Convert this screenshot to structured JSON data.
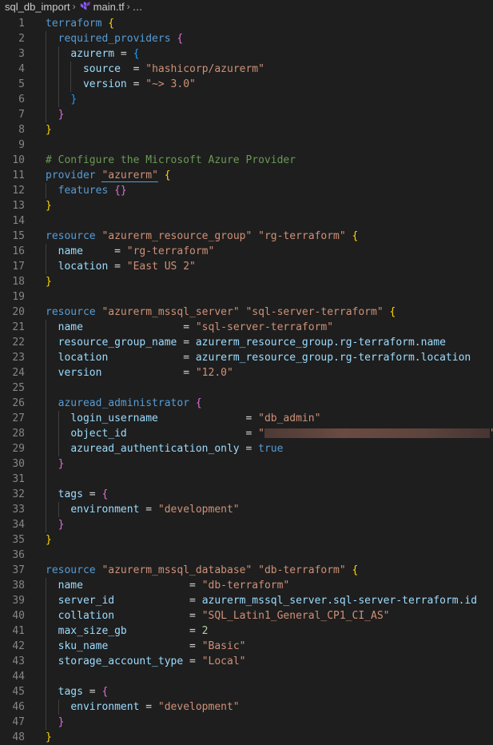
{
  "breadcrumb": {
    "folder": "sql_db_import",
    "file": "main.tf",
    "more": "…"
  },
  "editor": {
    "lines": [
      {
        "n": "1",
        "parts": [
          {
            "t": "terraform",
            "c": "kw"
          },
          {
            "t": " "
          },
          {
            "t": "{",
            "c": "br1"
          }
        ]
      },
      {
        "n": "2",
        "parts": [
          {
            "t": "  "
          },
          {
            "t": "required_providers",
            "c": "kw"
          },
          {
            "t": " "
          },
          {
            "t": "{",
            "c": "br2"
          }
        ]
      },
      {
        "n": "3",
        "parts": [
          {
            "t": "    "
          },
          {
            "t": "azurerm",
            "c": "id"
          },
          {
            "t": " = "
          },
          {
            "t": "{",
            "c": "br3"
          }
        ]
      },
      {
        "n": "4",
        "parts": [
          {
            "t": "      "
          },
          {
            "t": "source",
            "c": "id"
          },
          {
            "t": "  = "
          },
          {
            "t": "\"hashicorp/azurerm\"",
            "c": "str"
          }
        ]
      },
      {
        "n": "5",
        "parts": [
          {
            "t": "      "
          },
          {
            "t": "version",
            "c": "id"
          },
          {
            "t": " = "
          },
          {
            "t": "\"~> 3.0\"",
            "c": "str"
          }
        ]
      },
      {
        "n": "6",
        "parts": [
          {
            "t": "    "
          },
          {
            "t": "}",
            "c": "br3"
          }
        ]
      },
      {
        "n": "7",
        "parts": [
          {
            "t": "  "
          },
          {
            "t": "}",
            "c": "br2"
          }
        ]
      },
      {
        "n": "8",
        "parts": [
          {
            "t": "}",
            "c": "br1"
          }
        ]
      },
      {
        "n": "9",
        "parts": []
      },
      {
        "n": "10",
        "parts": [
          {
            "t": "# Configure the Microsoft Azure Provider",
            "c": "cm"
          }
        ]
      },
      {
        "n": "11",
        "parts": [
          {
            "t": "provider",
            "c": "kw"
          },
          {
            "t": " "
          },
          {
            "t": "\"azurerm\"",
            "c": "str",
            "ul": true
          },
          {
            "t": " "
          },
          {
            "t": "{",
            "c": "br1"
          }
        ]
      },
      {
        "n": "12",
        "parts": [
          {
            "t": "  "
          },
          {
            "t": "features",
            "c": "kw"
          },
          {
            "t": " "
          },
          {
            "t": "{}",
            "c": "br2"
          }
        ]
      },
      {
        "n": "13",
        "parts": [
          {
            "t": "}",
            "c": "br1"
          }
        ]
      },
      {
        "n": "14",
        "parts": []
      },
      {
        "n": "15",
        "parts": [
          {
            "t": "resource",
            "c": "kw"
          },
          {
            "t": " "
          },
          {
            "t": "\"azurerm_resource_group\"",
            "c": "str"
          },
          {
            "t": " "
          },
          {
            "t": "\"rg-terraform\"",
            "c": "str"
          },
          {
            "t": " "
          },
          {
            "t": "{",
            "c": "br1"
          }
        ]
      },
      {
        "n": "16",
        "parts": [
          {
            "t": "  "
          },
          {
            "t": "name",
            "c": "id"
          },
          {
            "t": "     = "
          },
          {
            "t": "\"rg-terraform\"",
            "c": "str"
          }
        ]
      },
      {
        "n": "17",
        "parts": [
          {
            "t": "  "
          },
          {
            "t": "location",
            "c": "id"
          },
          {
            "t": " = "
          },
          {
            "t": "\"East US 2\"",
            "c": "str"
          }
        ]
      },
      {
        "n": "18",
        "parts": [
          {
            "t": "}",
            "c": "br1"
          }
        ]
      },
      {
        "n": "19",
        "parts": []
      },
      {
        "n": "20",
        "parts": [
          {
            "t": "resource",
            "c": "kw"
          },
          {
            "t": " "
          },
          {
            "t": "\"azurerm_mssql_server\"",
            "c": "str"
          },
          {
            "t": " "
          },
          {
            "t": "\"sql-server-terraform\"",
            "c": "str"
          },
          {
            "t": " "
          },
          {
            "t": "{",
            "c": "br1"
          }
        ]
      },
      {
        "n": "21",
        "parts": [
          {
            "t": "  "
          },
          {
            "t": "name",
            "c": "id"
          },
          {
            "t": "                = "
          },
          {
            "t": "\"sql-server-terraform\"",
            "c": "str"
          }
        ]
      },
      {
        "n": "22",
        "parts": [
          {
            "t": "  "
          },
          {
            "t": "resource_group_name",
            "c": "id"
          },
          {
            "t": " = "
          },
          {
            "t": "azurerm_resource_group.rg-terraform.name",
            "c": "id"
          }
        ]
      },
      {
        "n": "23",
        "parts": [
          {
            "t": "  "
          },
          {
            "t": "location",
            "c": "id"
          },
          {
            "t": "            = "
          },
          {
            "t": "azurerm_resource_group.rg-terraform.location",
            "c": "id"
          }
        ]
      },
      {
        "n": "24",
        "parts": [
          {
            "t": "  "
          },
          {
            "t": "version",
            "c": "id"
          },
          {
            "t": "             = "
          },
          {
            "t": "\"12.0\"",
            "c": "str"
          }
        ]
      },
      {
        "n": "25",
        "parts": []
      },
      {
        "n": "26",
        "parts": [
          {
            "t": "  "
          },
          {
            "t": "azuread_administrator",
            "c": "kw"
          },
          {
            "t": " "
          },
          {
            "t": "{",
            "c": "br2"
          }
        ]
      },
      {
        "n": "27",
        "parts": [
          {
            "t": "    "
          },
          {
            "t": "login_username",
            "c": "id"
          },
          {
            "t": "              = "
          },
          {
            "t": "\"db_admin\"",
            "c": "str"
          }
        ]
      },
      {
        "n": "28",
        "parts": [
          {
            "t": "    "
          },
          {
            "t": "object_id",
            "c": "id"
          },
          {
            "t": "                   = "
          },
          {
            "t": "\"",
            "c": "str"
          },
          {
            "redacted": true
          },
          {
            "t": "\"",
            "c": "str"
          }
        ]
      },
      {
        "n": "29",
        "parts": [
          {
            "t": "    "
          },
          {
            "t": "azuread_authentication_only",
            "c": "id"
          },
          {
            "t": " = "
          },
          {
            "t": "true",
            "c": "kw"
          }
        ]
      },
      {
        "n": "30",
        "parts": [
          {
            "t": "  "
          },
          {
            "t": "}",
            "c": "br2"
          }
        ]
      },
      {
        "n": "31",
        "parts": []
      },
      {
        "n": "32",
        "parts": [
          {
            "t": "  "
          },
          {
            "t": "tags",
            "c": "id"
          },
          {
            "t": " = "
          },
          {
            "t": "{",
            "c": "br2"
          }
        ]
      },
      {
        "n": "33",
        "parts": [
          {
            "t": "    "
          },
          {
            "t": "environment",
            "c": "id"
          },
          {
            "t": " = "
          },
          {
            "t": "\"development\"",
            "c": "str"
          }
        ]
      },
      {
        "n": "34",
        "parts": [
          {
            "t": "  "
          },
          {
            "t": "}",
            "c": "br2"
          }
        ]
      },
      {
        "n": "35",
        "parts": [
          {
            "t": "}",
            "c": "br1"
          }
        ]
      },
      {
        "n": "36",
        "parts": []
      },
      {
        "n": "37",
        "parts": [
          {
            "t": "resource",
            "c": "kw"
          },
          {
            "t": " "
          },
          {
            "t": "\"azurerm_mssql_database\"",
            "c": "str"
          },
          {
            "t": " "
          },
          {
            "t": "\"db-terraform\"",
            "c": "str"
          },
          {
            "t": " "
          },
          {
            "t": "{",
            "c": "br1"
          }
        ]
      },
      {
        "n": "38",
        "parts": [
          {
            "t": "  "
          },
          {
            "t": "name",
            "c": "id"
          },
          {
            "t": "                 = "
          },
          {
            "t": "\"db-terraform\"",
            "c": "str"
          }
        ]
      },
      {
        "n": "39",
        "parts": [
          {
            "t": "  "
          },
          {
            "t": "server_id",
            "c": "id"
          },
          {
            "t": "            = "
          },
          {
            "t": "azurerm_mssql_server.sql-server-terraform.id",
            "c": "id"
          }
        ]
      },
      {
        "n": "40",
        "parts": [
          {
            "t": "  "
          },
          {
            "t": "collation",
            "c": "id"
          },
          {
            "t": "            = "
          },
          {
            "t": "\"SQL_Latin1_General_CP1_CI_AS\"",
            "c": "str"
          }
        ]
      },
      {
        "n": "41",
        "parts": [
          {
            "t": "  "
          },
          {
            "t": "max_size_gb",
            "c": "id"
          },
          {
            "t": "          = "
          },
          {
            "t": "2",
            "c": "num"
          }
        ]
      },
      {
        "n": "42",
        "parts": [
          {
            "t": "  "
          },
          {
            "t": "sku_name",
            "c": "id"
          },
          {
            "t": "             = "
          },
          {
            "t": "\"Basic\"",
            "c": "str"
          }
        ]
      },
      {
        "n": "43",
        "parts": [
          {
            "t": "  "
          },
          {
            "t": "storage_account_type",
            "c": "id"
          },
          {
            "t": " = "
          },
          {
            "t": "\"Local\"",
            "c": "str"
          }
        ]
      },
      {
        "n": "44",
        "parts": []
      },
      {
        "n": "45",
        "parts": [
          {
            "t": "  "
          },
          {
            "t": "tags",
            "c": "id"
          },
          {
            "t": " = "
          },
          {
            "t": "{",
            "c": "br2"
          }
        ]
      },
      {
        "n": "46",
        "parts": [
          {
            "t": "    "
          },
          {
            "t": "environment",
            "c": "id"
          },
          {
            "t": " = "
          },
          {
            "t": "\"development\"",
            "c": "str"
          }
        ]
      },
      {
        "n": "47",
        "parts": [
          {
            "t": "  "
          },
          {
            "t": "}",
            "c": "br2"
          }
        ]
      },
      {
        "n": "48",
        "parts": [
          {
            "t": "}",
            "c": "br1"
          }
        ]
      }
    ]
  }
}
